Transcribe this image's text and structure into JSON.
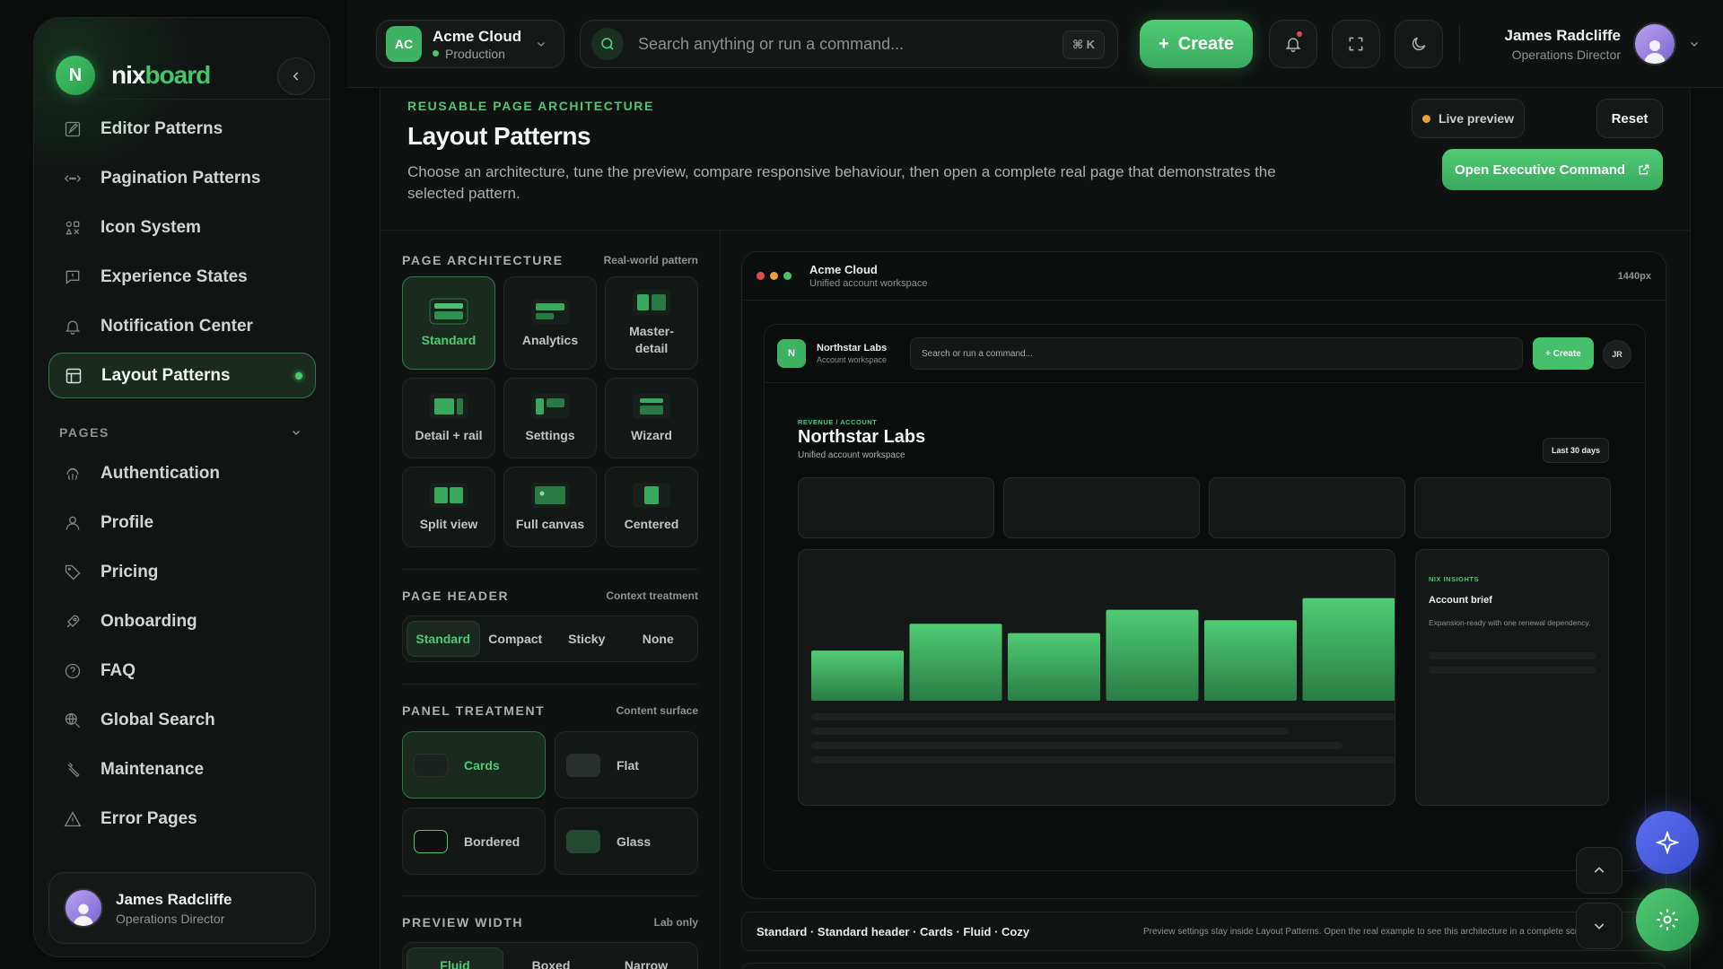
{
  "brand": {
    "prefix": "nix",
    "suffix": "board",
    "logo_letter": "N"
  },
  "sidebar": {
    "items": [
      {
        "label": "Editor Patterns",
        "icon": "edit-icon"
      },
      {
        "label": "Pagination Patterns",
        "icon": "pagination-icon"
      },
      {
        "label": "Icon System",
        "icon": "icon-system-icon"
      },
      {
        "label": "Experience States",
        "icon": "message-icon"
      },
      {
        "label": "Notification Center",
        "icon": "bell-icon"
      },
      {
        "label": "Layout Patterns",
        "icon": "layout-icon",
        "active": true
      }
    ],
    "pages_label": "PAGES",
    "pages": [
      {
        "label": "Authentication",
        "icon": "fingerprint-icon"
      },
      {
        "label": "Profile",
        "icon": "user-icon"
      },
      {
        "label": "Pricing",
        "icon": "tag-icon"
      },
      {
        "label": "Onboarding",
        "icon": "rocket-icon"
      },
      {
        "label": "FAQ",
        "icon": "question-icon"
      },
      {
        "label": "Global Search",
        "icon": "globe-search-icon"
      },
      {
        "label": "Maintenance",
        "icon": "wrench-icon"
      },
      {
        "label": "Error Pages",
        "icon": "warning-icon"
      }
    ],
    "user": {
      "name": "James Radcliffe",
      "role": "Operations Director"
    }
  },
  "topbar": {
    "workspace": {
      "initials": "AC",
      "name": "Acme Cloud",
      "env": "Production"
    },
    "search_placeholder": "Search anything or run a command...",
    "shortcut": "⌘ K",
    "create_label": "Create",
    "user": {
      "name": "James Radcliffe",
      "role": "Operations Director"
    }
  },
  "hero": {
    "eyebrow": "REUSABLE PAGE ARCHITECTURE",
    "title": "Layout Patterns",
    "description": "Choose an architecture, tune the preview, compare responsive behaviour, then open a complete real page that demonstrates the selected pattern.",
    "live_preview": "Live preview",
    "reset": "Reset",
    "open_button": "Open Executive Command"
  },
  "controls": {
    "architecture": {
      "title": "PAGE ARCHITECTURE",
      "subtitle": "Real-world pattern",
      "options": [
        "Standard",
        "Analytics",
        "Master-detail",
        "Detail + rail",
        "Settings",
        "Wizard",
        "Split view",
        "Full canvas",
        "Centered"
      ],
      "selected": "Standard"
    },
    "header": {
      "title": "PAGE HEADER",
      "subtitle": "Context treatment",
      "options": [
        "Standard",
        "Compact",
        "Sticky",
        "None"
      ],
      "selected": "Standard"
    },
    "panel": {
      "title": "PANEL TREATMENT",
      "subtitle": "Content surface",
      "options": [
        "Cards",
        "Flat",
        "Bordered",
        "Glass"
      ],
      "selected": "Cards"
    },
    "width": {
      "title": "PREVIEW WIDTH",
      "subtitle": "Lab only",
      "options": [
        "Fluid",
        "Boxed",
        "Narrow"
      ],
      "selected": "Fluid"
    }
  },
  "preview": {
    "app_name": "Acme Cloud",
    "subtitle": "Unified account workspace",
    "width_label": "1440px",
    "org": {
      "name": "Northstar Labs",
      "sub": "Account workspace",
      "letter": "N"
    },
    "search": "Search or run a command...",
    "create": "+ Create",
    "avatar": "JR",
    "eyebrow": "REVENUE / ACCOUNT",
    "title": "Northstar Labs",
    "range": "Last 30 days",
    "chart_values": [
      0.43,
      0.66,
      0.58,
      0.78,
      0.69,
      0.88
    ],
    "insight": {
      "eyebrow": "NIX INSIGHTS",
      "title": "Account brief",
      "desc": "Expansion-ready with one renewal dependency."
    }
  },
  "status": {
    "summary": "Standard · Standard header · Cards · Fluid · Cozy",
    "note": "Preview settings stay inside Layout Patterns. Open the real example to see this architecture in a complete screen."
  },
  "colors": {
    "accent": "#47c56c",
    "background": "#0b0d0c",
    "surface": "#141817",
    "assistant": "#4a5fe0"
  }
}
